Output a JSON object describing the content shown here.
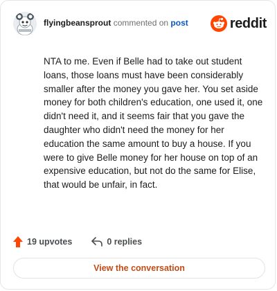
{
  "header": {
    "username": "flyingbeansprout",
    "action": "commented on",
    "post_link": "post",
    "logo_text": "reddit",
    "avatar_icon": "snoo-avatar-icon",
    "logo_icon": "reddit-alien-icon"
  },
  "comment": {
    "body": "NTA to me. Even if Belle had to take out student loans, those loans must have been considerably smaller after the money you gave her. You set aside money for both children's education, one used it, one didn't need it, and it seems fair that you gave the daughter who didn't need the money for her education the same amount to buy a house. If you were to give Belle money for her house on top of an expensive education, but not do the same for Elise, that would be unfair, in fact."
  },
  "stats": {
    "upvotes_label": "19 upvotes",
    "replies_label": "0 replies",
    "upvote_icon": "upvote-arrow-icon",
    "reply_icon": "reply-arrow-icon"
  },
  "cta": {
    "label": "View the conversation"
  },
  "colors": {
    "reddit_orange": "#ff4500",
    "link_blue": "#0a56c2",
    "cta_text": "#c34b16",
    "border": "#e6e6e6"
  }
}
